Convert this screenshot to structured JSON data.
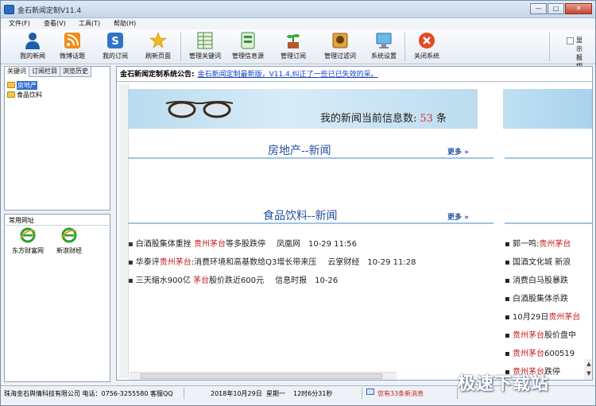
{
  "window": {
    "title": "金石新闻定制V11.4",
    "min": "—",
    "max": "□",
    "close": "✕"
  },
  "menu": [
    "文件(F)",
    "查看(V)",
    "工具(T)",
    "帮助(H)"
  ],
  "toolbar": [
    {
      "label": "我的新闻",
      "icon": "person-icon"
    },
    {
      "label": "微博话题",
      "icon": "rss-icon"
    },
    {
      "label": "我的订阅",
      "icon": "subscribe-icon"
    },
    {
      "label": "刷新页面",
      "icon": "refresh-star-icon"
    },
    {
      "label": "管理关键词",
      "icon": "keyword-grid-icon"
    },
    {
      "label": "管理信息源",
      "icon": "source-list-icon"
    },
    {
      "label": "管理订阅",
      "icon": "plant-pot-icon"
    },
    {
      "label": "管理过滤词",
      "icon": "filter-image-icon"
    },
    {
      "label": "系统设置",
      "icon": "monitor-icon"
    },
    {
      "label": "关闭系统",
      "icon": "close-circle-icon"
    }
  ],
  "display_option": "显示报摺",
  "left_tabs": [
    "关键词",
    "订阅栏目",
    "浏览历史"
  ],
  "tree": [
    "房地产",
    "食品饮料"
  ],
  "sites": {
    "title": "常用网址",
    "items": [
      "东方财富网",
      "新浪财经"
    ]
  },
  "notice": {
    "label": "金石新闻定制系统公告:",
    "text": "金石新闻定制最新版，V11.4,纠正了一些已已失效的采。"
  },
  "banner": {
    "prefix": "我的新闻当前信息数:",
    "count": "53",
    "suffix": "条"
  },
  "sections": [
    {
      "title": "房地产--新闻",
      "more": "更多 »"
    },
    {
      "title": "食品饮料--新闻",
      "more": "更多 »"
    }
  ],
  "news": [
    {
      "pre": "白酒股集体重挫 ",
      "red": "贵州茅台",
      "post": "等多股跌停",
      "source": "凤凰网",
      "time": "10-29 11:56"
    },
    {
      "pre": "华泰评",
      "red": "贵州茅台",
      "post": ":消费环境和高基数给Q3增长带来压",
      "source": "云掌财经",
      "time": "10-29 11:28"
    },
    {
      "pre": "三天缩水900亿 ",
      "red": "茅台",
      "post": "股价跌近600元",
      "source": "信息时报",
      "time": "10-26"
    }
  ],
  "right_news": [
    {
      "pre": "郭一鸣:",
      "red": "贵州茅台"
    },
    {
      "pre": "国酒文化城  新浪",
      "red": ""
    },
    {
      "pre": "消费白马股暴跌 ",
      "red": ""
    },
    {
      "pre": "白酒股集体杀跌 ",
      "red": ""
    },
    {
      "pre": "10月29日",
      "red": "贵州茅台"
    },
    {
      "pre": "",
      "red": "贵州茅台",
      "post": "股价盘中"
    },
    {
      "pre": "",
      "red": "贵州茅台",
      "post": "600519"
    },
    {
      "pre": "",
      "red": "贵州茅台",
      "post": "跌停"
    }
  ],
  "status": {
    "company": "珠海金石舆情科技有限公司 电话：0756-3255580 客服QQ",
    "date": "2018年10月29日",
    "weekday": "星期一",
    "time": "12时6分31秒",
    "message": "您有33条新消息"
  },
  "watermark": "极速下载站"
}
